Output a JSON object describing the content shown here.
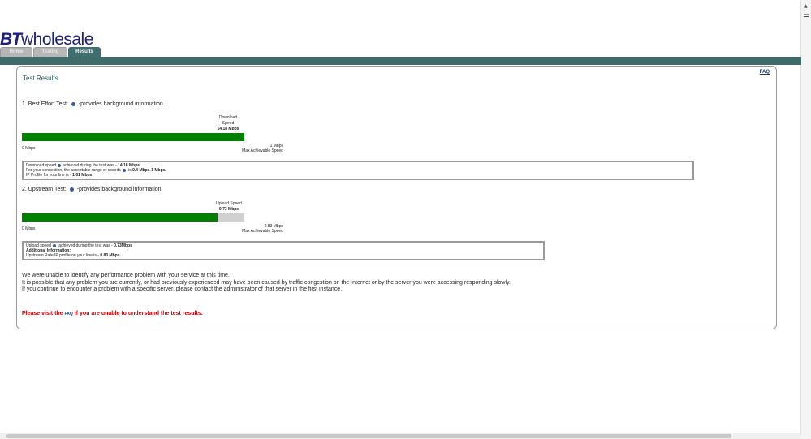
{
  "logo": {
    "bt": "BT",
    "wholesale": "wholesale"
  },
  "tabs": [
    {
      "label": "Home"
    },
    {
      "label": "Testing"
    },
    {
      "label": "Results"
    }
  ],
  "faq_link": "FAQ",
  "title": "Test Results",
  "best_effort": {
    "heading_prefix": "1. Best Effort Test:",
    "heading_suffix": "-provides background information.",
    "gauge_label_line1": "Download",
    "gauge_label_line2": "Speed",
    "speed": "14.18 Mbps",
    "fill_fraction": 1.0,
    "min": "0 Mbps",
    "max_value": "1 Mbps",
    "max_label": "Max Achievable Speed",
    "info": {
      "line1_prefix": "Download speed",
      "line1_mid": "achieved during the test was - ",
      "line1_value": "14.18 Mbps",
      "line2_prefix": "For your connection, the acceptable range of speeds",
      "line2_mid": " is ",
      "line2_value": "0.4 Mbps-1 Mbps.",
      "line3_prefix": "IP Profile for your line is - ",
      "line3_value": "1.01 Mbps"
    }
  },
  "upstream": {
    "heading_prefix": "2. Upstream Test:",
    "heading_suffix": "-provides background information.",
    "gauge_label": "Upload Speed",
    "speed": "0.73 Mbps",
    "fill_fraction": 0.88,
    "min": "0 Mbps",
    "max_value": "0.83 Mbps",
    "max_label": "Max Achievable Speed",
    "info": {
      "line1_prefix": "Upload speed",
      "line1_mid": " achieved during the test was - ",
      "line1_value": "0.73Mbps",
      "line2": "Additional Information:",
      "line3_prefix": "Upstream Rate IP profile on your line is - ",
      "line3_value": "0.83 Mbps"
    }
  },
  "message": {
    "line1": "We were unable to identify any performance problem with your service at this time.",
    "line2": "It is possible that any problem you are currently, or had previously experienced may have been caused by traffic congestion on the Internet or by the server you were accessing responding slowly.",
    "line3": "If you continue to encounter a problem with a specific server, please contact the administrator of that server in the first instance."
  },
  "visit": {
    "prefix": "Please visit the ",
    "link": "FAQ",
    "suffix": " if you are unable to understand the test results."
  },
  "colors": {
    "brand": "#1b1f77",
    "bar": "#3f6b6b",
    "fill": "#008000",
    "warning": "#cc0000"
  }
}
